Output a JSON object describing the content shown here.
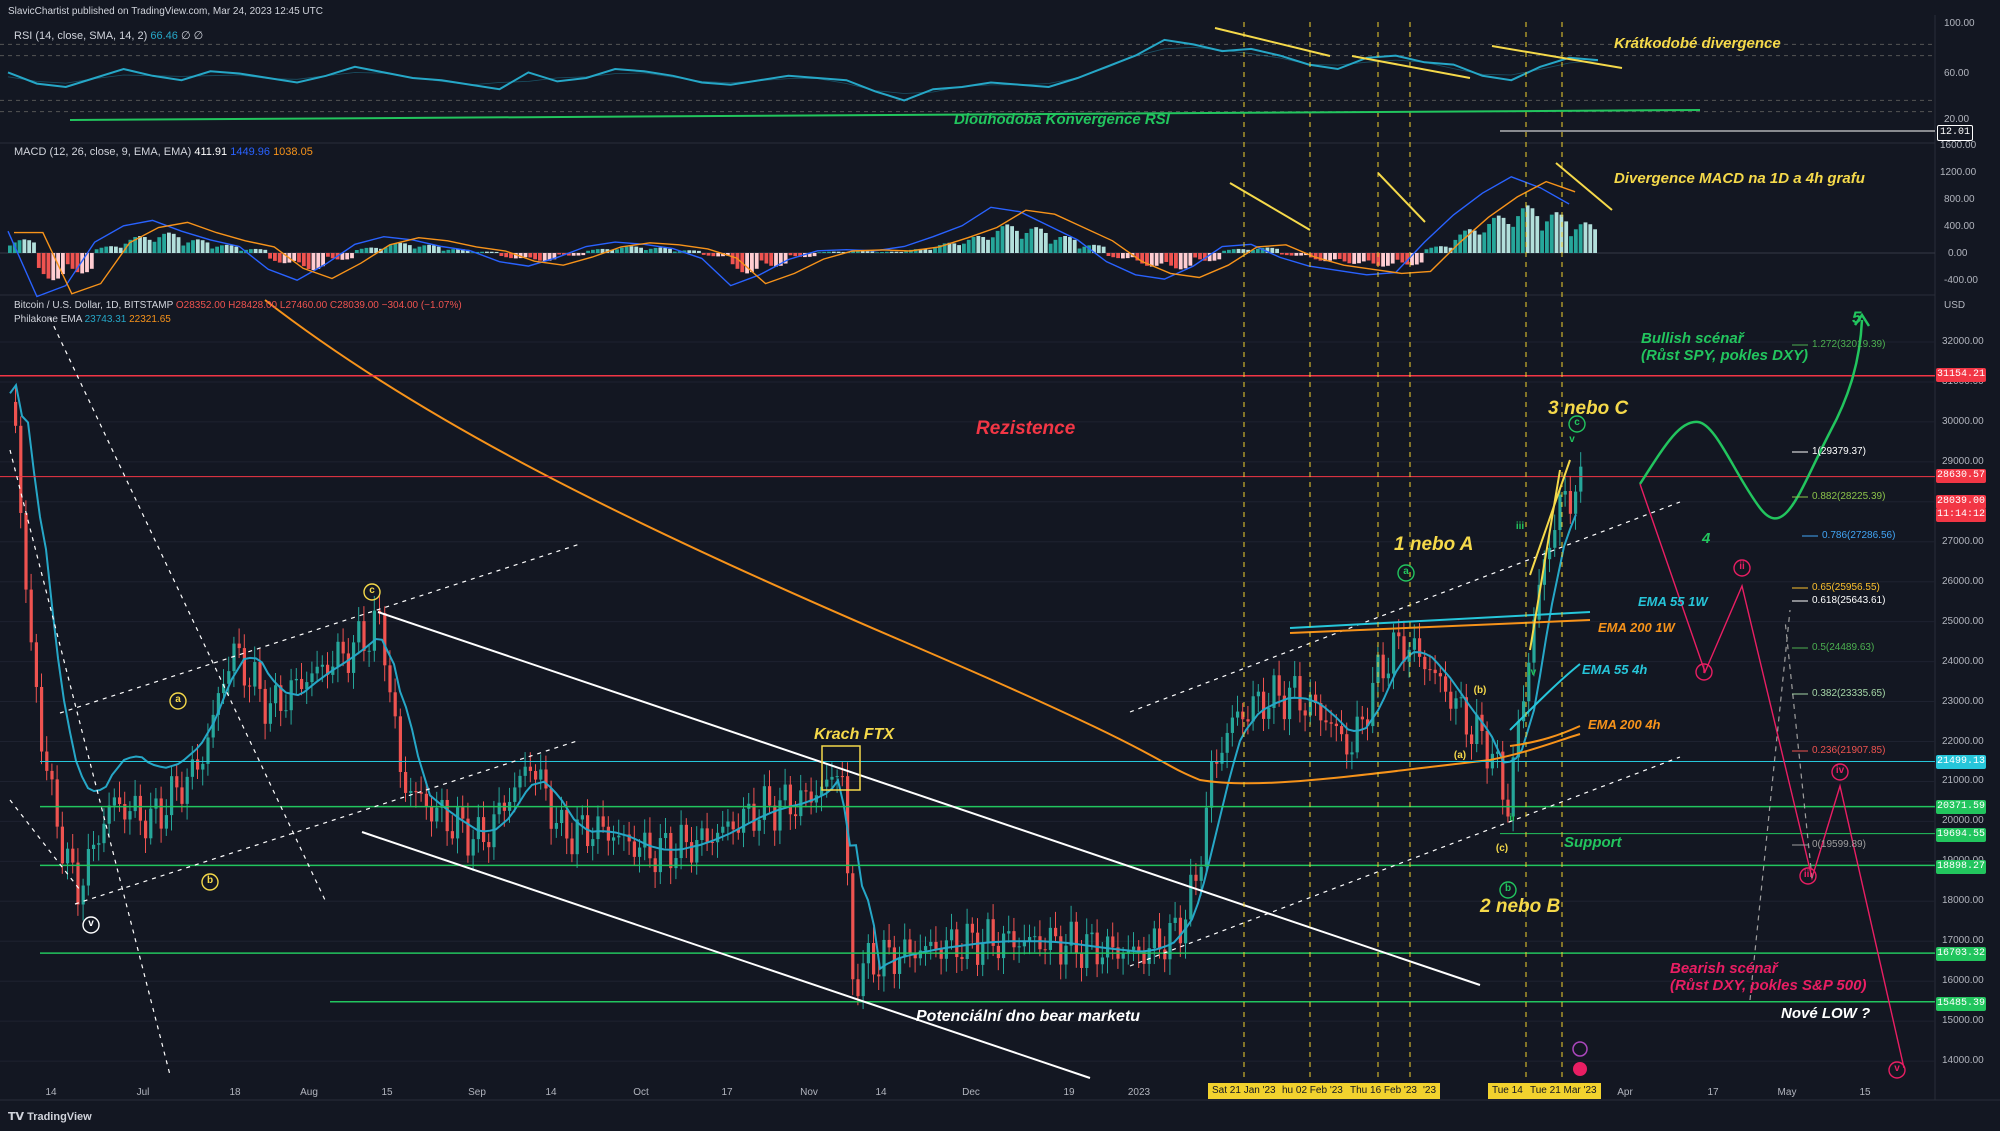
{
  "header": {
    "published": "SlavicChartist published on TradingView.com, Mar 24, 2023 12:45 UTC",
    "footer": "TradingView"
  },
  "rsi": {
    "label": "RSI (14, close, SMA, 14, 2)",
    "value": "66.46",
    "extra": "∅ ∅",
    "scale": [
      "100.00",
      "60.00",
      "20.00"
    ],
    "current_label": "12.01"
  },
  "macd": {
    "label": "MACD (12, 26, close, 9, EMA, EMA)",
    "v1": "411.91",
    "v2": "1449.96",
    "v3": "1038.05",
    "scale": [
      "1600.00",
      "1200.00",
      "800.00",
      "400.00",
      "0.00",
      "-400.00"
    ]
  },
  "price": {
    "title": "Bitcoin / U.S. Dollar, 1D, BITSTAMP",
    "ohlc": "O28352.00 H28428.00 L27460.00 C28039.00 −304.00 (−1.07%)",
    "ema_label": "Philakone EMA",
    "ema1": "23743.31",
    "ema2": "22321.65",
    "currency": "USD",
    "scale": [
      "32000.00",
      "31000.00",
      "30000.00",
      "29000.00",
      "28000.00",
      "27000.00",
      "26000.00",
      "25000.00",
      "24000.00",
      "23000.00",
      "22000.00",
      "21000.00",
      "20000.00",
      "19000.00",
      "18000.00",
      "17000.00",
      "16000.00",
      "15000.00",
      "14000.00"
    ],
    "levels": [
      {
        "value": "31154.21",
        "color": "#f23645"
      },
      {
        "value": "28630.57",
        "color": "#f23645"
      },
      {
        "value": "28039.00",
        "color": "#f23645"
      },
      {
        "value": "11:14:12",
        "color": "#f23645"
      },
      {
        "value": "21499.13",
        "color": "#26c6da"
      },
      {
        "value": "20371.59",
        "color": "#22c55e"
      },
      {
        "value": "19694.55",
        "color": "#22c55e"
      },
      {
        "value": "18898.27",
        "color": "#22c55e"
      },
      {
        "value": "16703.32",
        "color": "#22c55e"
      },
      {
        "value": "15485.39",
        "color": "#22c55e"
      }
    ],
    "fib": [
      {
        "label": "1.272(32019.39)",
        "color": "#4caf50"
      },
      {
        "label": "1(29379.37)",
        "color": "#ffffff"
      },
      {
        "label": "0.882(28225.39)",
        "color": "#8bc34a"
      },
      {
        "label": "0.786(27286.56)",
        "color": "#42a5f5"
      },
      {
        "label": "0.65(25956.55)",
        "color": "#fbc02d"
      },
      {
        "label": "0.618(25643.61)",
        "color": "#ffffff"
      },
      {
        "label": "0.5(24489.63)",
        "color": "#4caf50"
      },
      {
        "label": "0.382(23335.65)",
        "color": "#a5d6a7"
      },
      {
        "label": "0.236(21907.85)",
        "color": "#ef5350"
      },
      {
        "label": "0(19599.89)",
        "color": "#9e9e9e"
      }
    ]
  },
  "annotations": {
    "rsi_short_div": "Krátkodobé divergence",
    "rsi_long_conv": "Dlouhodobá Konvergence RSI",
    "macd_div": "Divergence MACD na 1D a 4h grafu",
    "resistance": "Rezistence",
    "bullish": "Bullish scénař",
    "bullish_sub": "(Růst SPY, pokles DXY)",
    "wave3": "3 nebo C",
    "wave1": "1 nebo A",
    "wave2": "2 nebo B",
    "ema55w": "EMA 55 1W",
    "ema200w": "EMA 200 1W",
    "ema55h": "EMA 55 4h",
    "ema200h": "EMA 200 4h",
    "ftx": "Krach FTX",
    "support": "Support",
    "bottom": "Potenciální dno bear marketu",
    "bearish": "Bearish scénař",
    "bearish_sub": "(Růst DXY, pokles S&P 500)",
    "new_low": "Nové LOW ?",
    "five": "5",
    "four": "4"
  },
  "wave_labels": {
    "a1": "a",
    "b1": "b",
    "c1": "c",
    "v1": "v",
    "a2": "a",
    "b2": "(b)",
    "a2p": "(a)",
    "c2": "(c)",
    "bw": "b",
    "cw": "c",
    "vv": "v",
    "iii": "iii",
    "iv": "iv",
    "ii": "ii",
    "ri": "i",
    "rii": "ii",
    "riii": "iii",
    "riv": "iv",
    "rv": "v"
  },
  "time_axis": {
    "ticks": [
      "14",
      "Jul",
      "18",
      "Aug",
      "15",
      "Sep",
      "14",
      "Oct",
      "17",
      "Nov",
      "14",
      "Dec",
      "19",
      "2023",
      "Mar",
      "Apr",
      "17",
      "May",
      "15"
    ],
    "badges": [
      "Sat 21 Jan '23",
      "hu 02 Feb '23",
      "Thu 16 Feb '23",
      "'23",
      "Tue 14",
      "Tue 21 Mar '23"
    ]
  },
  "colors": {
    "background": "#131722",
    "up": "#26a69a",
    "down": "#ef5350",
    "ema_blue": "#26a7c7",
    "ema_orange": "#f7931a",
    "annotation_yellow": "#f5d94a",
    "support_green": "#22c55e",
    "resistance_red": "#f23645",
    "bearish_pink": "#e91e63"
  },
  "chart_data": [
    {
      "type": "line",
      "title": "RSI (14, close, SMA, 14, 2)",
      "ylim": [
        0,
        100
      ],
      "series": [
        {
          "name": "RSI",
          "values": [
            55,
            45,
            42,
            50,
            58,
            52,
            48,
            56,
            54,
            50,
            46,
            52,
            60,
            55,
            50,
            48,
            44,
            40,
            55,
            47,
            50,
            58,
            56,
            52,
            46,
            44,
            48,
            52,
            50,
            48,
            38,
            30,
            40,
            42,
            46,
            44,
            42,
            50,
            60,
            70,
            84,
            80,
            74,
            76,
            70,
            62,
            58,
            68,
            70,
            64,
            62,
            52,
            48,
            60,
            68,
            66
          ]
        }
      ]
    },
    {
      "type": "bar",
      "title": "MACD (12, 26, close, 9, EMA, EMA)",
      "ylim": [
        -600,
        1600
      ],
      "series": [
        {
          "name": "Histogram",
          "values": [
            200,
            -400,
            -300,
            100,
            250,
            300,
            200,
            120,
            60,
            -150,
            -250,
            -100,
            80,
            150,
            120,
            60,
            20,
            -80,
            -120,
            -40,
            60,
            100,
            80,
            40,
            -50,
            -300,
            -200,
            -60,
            20,
            30,
            20,
            60,
            150,
            250,
            420,
            380,
            250,
            120,
            -80,
            -200,
            -240,
            -120,
            60,
            80,
            -40,
            -120,
            -160,
            -200,
            -180,
            100,
            350,
            550,
            700,
            600,
            450
          ]
        }
      ]
    },
    {
      "type": "bar",
      "title": "Bitcoin / U.S. Dollar, 1D, BITSTAMP",
      "x": [
        "Jun 2022",
        "Jul 2022",
        "Aug 2022",
        "Sep 2022",
        "Oct 2022",
        "Nov 2022",
        "Dec 2022",
        "Jan 2023",
        "Feb 2023",
        "Mar 2023"
      ],
      "ylim": [
        14000,
        33000
      ],
      "series": [
        {
          "name": "Close",
          "values": [
            19900,
            23300,
            20100,
            19400,
            20500,
            17100,
            16550,
            23100,
            23150,
            28039
          ]
        }
      ]
    }
  ]
}
